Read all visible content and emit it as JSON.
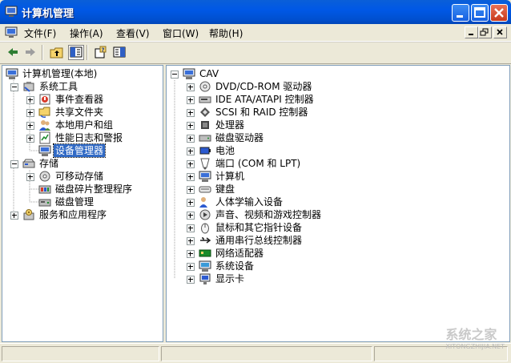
{
  "window": {
    "title": "计算机管理"
  },
  "menu": {
    "items": [
      {
        "label": "文件(F)"
      },
      {
        "label": "操作(A)"
      },
      {
        "label": "查看(V)"
      },
      {
        "label": "窗口(W)"
      },
      {
        "label": "帮助(H)"
      }
    ]
  },
  "left_tree": {
    "root": "计算机管理(本地)",
    "system_tools": "系统工具",
    "event_viewer": "事件查看器",
    "shared_folders": "共享文件夹",
    "local_users": "本地用户和组",
    "perf_logs": "性能日志和警报",
    "device_manager": "设备管理器",
    "storage": "存储",
    "removable_storage": "可移动存储",
    "defrag": "磁盘碎片整理程序",
    "disk_mgmt": "磁盘管理",
    "services_apps": "服务和应用程序"
  },
  "right_tree": {
    "root": "CAV",
    "devices": [
      "DVD/CD-ROM 驱动器",
      "IDE ATA/ATAPI 控制器",
      "SCSI 和 RAID 控制器",
      "处理器",
      "磁盘驱动器",
      "电池",
      "端口 (COM 和 LPT)",
      "计算机",
      "键盘",
      "人体学输入设备",
      "声音、视频和游戏控制器",
      "鼠标和其它指针设备",
      "通用串行总线控制器",
      "网络适配器",
      "系统设备",
      "显示卡"
    ]
  },
  "watermark": {
    "text": "系统之家",
    "sub": "XITONGZHIJIA.NET"
  }
}
